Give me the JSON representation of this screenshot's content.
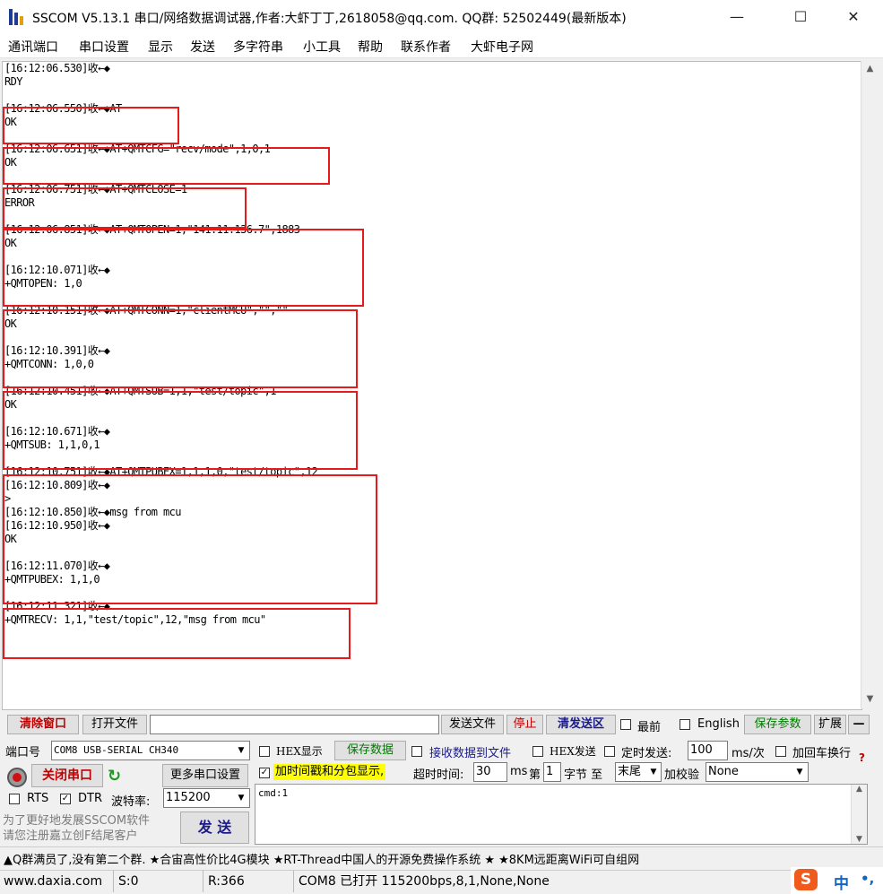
{
  "window": {
    "title": "SSCOM V5.13.1 串口/网络数据调试器,作者:大虾丁丁,2618058@qq.com. QQ群: 52502449(最新版本)",
    "minimize_glyph": "—",
    "maximize_glyph": "☐",
    "close_glyph": "✕"
  },
  "menu": [
    "通讯端口",
    "串口设置",
    "显示",
    "发送",
    "多字符串",
    "小工具",
    "帮助",
    "联系作者",
    "大虾电子网"
  ],
  "log_lines": [
    "[16:12:06.530]收←◆",
    "RDY",
    "",
    "[16:12:06.550]收←◆AT",
    "OK",
    "",
    "[16:12:06.651]收←◆AT+QMTCFG=\"recv/mode\",1,0,1",
    "OK",
    "",
    "[16:12:06.751]收←◆AT+QMTCLOSE=1",
    "ERROR",
    "",
    "[16:12:06.851]收←◆AT+QMTOPEN=1,\"141.11.136.7\",1883",
    "OK",
    "",
    "[16:12:10.071]收←◆",
    "+QMTOPEN: 1,0",
    "",
    "[16:12:10.151]收←◆AT+QMTCONN=1,\"clientMCU\",\"\",\"\"",
    "OK",
    "",
    "[16:12:10.391]收←◆",
    "+QMTCONN: 1,0,0",
    "",
    "[16:12:10.451]收←◆AT+QMTSUB=1,1,\"test/topic\",1",
    "OK",
    "",
    "[16:12:10.671]收←◆",
    "+QMTSUB: 1,1,0,1",
    "",
    "[16:12:10.751]收←◆AT+QMTPUBEX=1,1,1,0,\"test/topic\",12",
    "[16:12:10.809]收←◆",
    ">",
    "[16:12:10.850]收←◆msg from mcu",
    "[16:12:10.950]收←◆",
    "OK",
    "",
    "[16:12:11.070]收←◆",
    "+QMTPUBEX: 1,1,0",
    "",
    "[16:12:11.321]收←◆",
    "+QMTRECV: 1,1,\"test/topic\",12,\"msg from mcu\""
  ],
  "toolbar": {
    "clear_window": "清除窗口",
    "open_file": "打开文件",
    "file_path": "",
    "send_file": "发送文件",
    "stop": "停止",
    "clear_send_area": "清发送区",
    "topmost_label": "最前",
    "english_label": "English",
    "save_params": "保存参数",
    "expand": "扩展",
    "collapse": "—"
  },
  "port": {
    "port_label": "端口号",
    "port_value": "COM8 USB-SERIAL CH340",
    "close_port": "关闭串口",
    "more_settings": "更多串口设置",
    "rts_label": "RTS",
    "dtr_label": "DTR",
    "rts_checked": false,
    "dtr_checked": true,
    "baud_label": "波特率:",
    "baud_value": "115200"
  },
  "options": {
    "hex_display": "HEX显示",
    "save_data": "保存数据",
    "recv_to_file": "接收数据到文件",
    "hex_send": "HEX发送",
    "timed_send": "定时发送:",
    "interval_value": "100",
    "interval_unit": "ms/次",
    "add_crlf": "加回车换行",
    "timestamp_label": "加时间戳和分包显示,",
    "timestamp_checked": true,
    "timeout_label": "超时时间:",
    "timeout_value": "30",
    "timeout_unit": "ms",
    "byte_prefix": "第",
    "byte_index": "1",
    "byte_suffix": "字节 至",
    "end_value": "末尾",
    "checksum_label": "加校验",
    "checksum_value": "None",
    "help": "?"
  },
  "send": {
    "promo": "为了更好地发展SSCOM软件\n请您注册嘉立创F结尾客户",
    "send_button": "发 送",
    "input_text": "cmd:1"
  },
  "ticker": "▲Q群满员了,没有第二个群. ★合宙高性价比4G模块 ★RT-Thread中国人的开源免费操作系统 ★ ★8KM远距离WiFi可自组网",
  "status": {
    "website": "www.daxia.com",
    "sent": "S:0",
    "received": "R:366",
    "port_state": "COM8 已打开  115200bps,8,1,None,None"
  },
  "ime": {
    "logo": "S",
    "lang": "中",
    "punct": "•,"
  },
  "colors": {
    "highlight_box": "#e8191b",
    "timestamp_bg": "#ffff00",
    "accent_green": "#007a00",
    "accent_red": "#c00000"
  }
}
